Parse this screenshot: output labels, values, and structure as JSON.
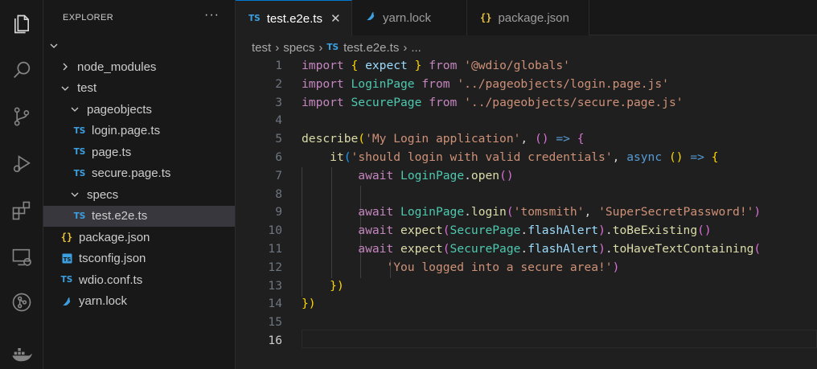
{
  "sidebar": {
    "title": "EXPLORER",
    "more": "···",
    "tree": [
      {
        "label": "node_modules",
        "kind": "folder",
        "open": false,
        "depth": 1
      },
      {
        "label": "test",
        "kind": "folder",
        "open": true,
        "depth": 1
      },
      {
        "label": "pageobjects",
        "kind": "folder",
        "open": true,
        "depth": 2
      },
      {
        "label": "login.page.ts",
        "kind": "ts",
        "depth": 3
      },
      {
        "label": "page.ts",
        "kind": "ts",
        "depth": 3
      },
      {
        "label": "secure.page.ts",
        "kind": "ts",
        "depth": 3
      },
      {
        "label": "specs",
        "kind": "folder",
        "open": true,
        "depth": 2
      },
      {
        "label": "test.e2e.ts",
        "kind": "ts",
        "depth": 3,
        "selected": true
      },
      {
        "label": "package.json",
        "kind": "json",
        "depth": 1
      },
      {
        "label": "tsconfig.json",
        "kind": "tsconfig",
        "depth": 1
      },
      {
        "label": "wdio.conf.ts",
        "kind": "ts",
        "depth": 1
      },
      {
        "label": "yarn.lock",
        "kind": "yarn",
        "depth": 1
      }
    ]
  },
  "tabs": [
    {
      "label": "test.e2e.ts",
      "icon": "TS",
      "active": true,
      "close": "✕"
    },
    {
      "label": "yarn.lock",
      "icon": "yarn-icon"
    },
    {
      "label": "package.json",
      "icon": "{}"
    }
  ],
  "breadcrumb": {
    "parts": [
      "test",
      "specs"
    ],
    "file_icon": "TS",
    "file": "test.e2e.ts",
    "tail": "..."
  },
  "editor": {
    "current_line": 16,
    "lines": [
      [
        [
          "kw",
          "import"
        ],
        [
          "pl",
          " "
        ],
        [
          "b1",
          "{"
        ],
        [
          "pl",
          " "
        ],
        [
          "var",
          "expect"
        ],
        [
          "pl",
          " "
        ],
        [
          "b1",
          "}"
        ],
        [
          "pl",
          " "
        ],
        [
          "kw",
          "from"
        ],
        [
          "pl",
          " "
        ],
        [
          "str",
          "'@wdio/globals'"
        ]
      ],
      [
        [
          "kw",
          "import"
        ],
        [
          "pl",
          " "
        ],
        [
          "cls",
          "LoginPage"
        ],
        [
          "pl",
          " "
        ],
        [
          "kw",
          "from"
        ],
        [
          "pl",
          " "
        ],
        [
          "str",
          "'../pageobjects/login.page.js'"
        ]
      ],
      [
        [
          "kw",
          "import"
        ],
        [
          "pl",
          " "
        ],
        [
          "cls",
          "SecurePage"
        ],
        [
          "pl",
          " "
        ],
        [
          "kw",
          "from"
        ],
        [
          "pl",
          " "
        ],
        [
          "str",
          "'../pageobjects/secure.page.js'"
        ]
      ],
      [],
      [
        [
          "fn",
          "describe"
        ],
        [
          "b1",
          "("
        ],
        [
          "str",
          "'My Login application'"
        ],
        [
          "pl",
          ", "
        ],
        [
          "b2",
          "()"
        ],
        [
          "pl",
          " "
        ],
        [
          "kw2",
          "=>"
        ],
        [
          "pl",
          " "
        ],
        [
          "b2",
          "{"
        ]
      ],
      [
        [
          "pl",
          "    "
        ],
        [
          "fn",
          "it"
        ],
        [
          "b3",
          "("
        ],
        [
          "str",
          "'should login with valid credentials'"
        ],
        [
          "pl",
          ", "
        ],
        [
          "kw2",
          "async"
        ],
        [
          "pl",
          " "
        ],
        [
          "b1",
          "()"
        ],
        [
          "pl",
          " "
        ],
        [
          "kw2",
          "=>"
        ],
        [
          "pl",
          " "
        ],
        [
          "b1",
          "{"
        ]
      ],
      [
        [
          "pl",
          "        "
        ],
        [
          "kw",
          "await"
        ],
        [
          "pl",
          " "
        ],
        [
          "cls",
          "LoginPage"
        ],
        [
          "pl",
          "."
        ],
        [
          "fn",
          "open"
        ],
        [
          "b2",
          "()"
        ]
      ],
      [],
      [
        [
          "pl",
          "        "
        ],
        [
          "kw",
          "await"
        ],
        [
          "pl",
          " "
        ],
        [
          "cls",
          "LoginPage"
        ],
        [
          "pl",
          "."
        ],
        [
          "fn",
          "login"
        ],
        [
          "b2",
          "("
        ],
        [
          "str",
          "'tomsmith'"
        ],
        [
          "pl",
          ", "
        ],
        [
          "str",
          "'SuperSecretPassword!'"
        ],
        [
          "b2",
          ")"
        ]
      ],
      [
        [
          "pl",
          "        "
        ],
        [
          "kw",
          "await"
        ],
        [
          "pl",
          " "
        ],
        [
          "fn",
          "expect"
        ],
        [
          "b2",
          "("
        ],
        [
          "cls",
          "SecurePage"
        ],
        [
          "pl",
          "."
        ],
        [
          "var",
          "flashAlert"
        ],
        [
          "b2",
          ")"
        ],
        [
          "pl",
          "."
        ],
        [
          "fn",
          "toBeExisting"
        ],
        [
          "b2",
          "()"
        ]
      ],
      [
        [
          "pl",
          "        "
        ],
        [
          "kw",
          "await"
        ],
        [
          "pl",
          " "
        ],
        [
          "fn",
          "expect"
        ],
        [
          "b2",
          "("
        ],
        [
          "cls",
          "SecurePage"
        ],
        [
          "pl",
          "."
        ],
        [
          "var",
          "flashAlert"
        ],
        [
          "b2",
          ")"
        ],
        [
          "pl",
          "."
        ],
        [
          "fn",
          "toHaveTextContaining"
        ],
        [
          "b2",
          "("
        ]
      ],
      [
        [
          "pl",
          "            "
        ],
        [
          "str",
          "'You logged into a secure area!'"
        ],
        [
          "b2",
          ")"
        ]
      ],
      [
        [
          "pl",
          "    "
        ],
        [
          "b1",
          "})"
        ]
      ],
      [
        [
          "b1",
          "})"
        ]
      ],
      [],
      []
    ]
  }
}
